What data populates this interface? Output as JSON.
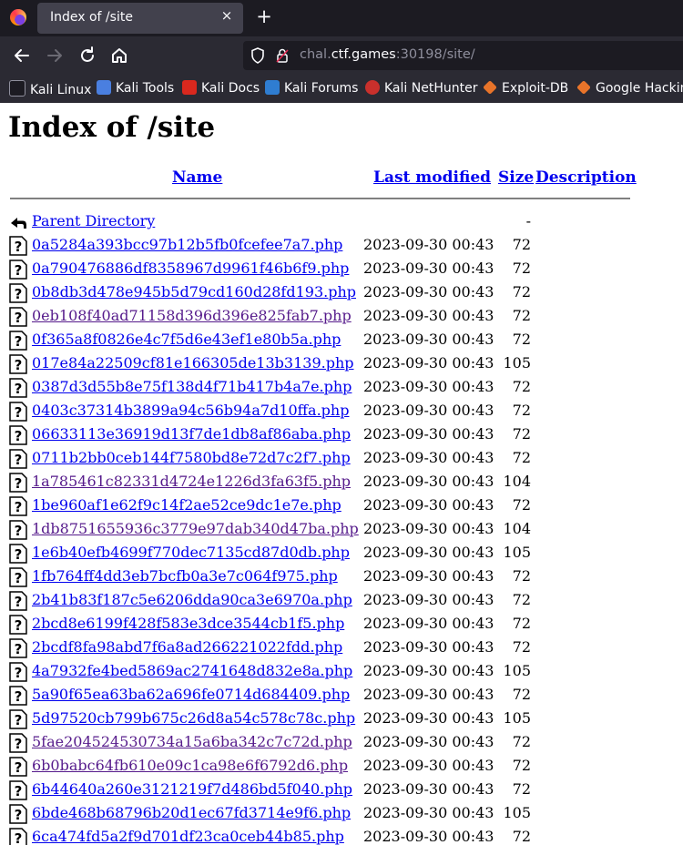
{
  "browser": {
    "tab_title": "Index of /site",
    "close_glyph": "×",
    "newtab_glyph": "+",
    "url_prefix": "chal.",
    "url_host": "ctf.games",
    "url_suffix": ":30198/site/",
    "bookmarks": [
      {
        "label": "Kali Linux",
        "color": "#3c7fc6"
      },
      {
        "label": "Kali Tools",
        "color": "#4a7fe0"
      },
      {
        "label": "Kali Docs",
        "color": "#d9281e"
      },
      {
        "label": "Kali Forums",
        "color": "#2f7dd1"
      },
      {
        "label": "Kali NetHunter",
        "color": "#c9302c"
      },
      {
        "label": "Exploit-DB",
        "color": "#e8742a"
      },
      {
        "label": "Google Hacking",
        "color": "#e8742a"
      }
    ]
  },
  "page": {
    "heading": "Index of /site",
    "columns": {
      "name": "Name",
      "modified": "Last modified",
      "size": "Size",
      "description": "Description"
    },
    "parent": {
      "name": "Parent Directory",
      "size": "-"
    },
    "rows": [
      {
        "name": "0a5284a393bcc97b12b5fb0fcefee7a7.php",
        "modified": "2023-09-30 00:43",
        "size": "72",
        "visited": false
      },
      {
        "name": "0a790476886df8358967d9961f46b6f9.php",
        "modified": "2023-09-30 00:43",
        "size": "72",
        "visited": false
      },
      {
        "name": "0b8db3d478e945b5d79cd160d28fd193.php",
        "modified": "2023-09-30 00:43",
        "size": "72",
        "visited": false
      },
      {
        "name": "0eb108f40ad71158d396d396e825fab7.php",
        "modified": "2023-09-30 00:43",
        "size": "72",
        "visited": true
      },
      {
        "name": "0f365a8f0826e4c7f5d6e43ef1e80b5a.php",
        "modified": "2023-09-30 00:43",
        "size": "72",
        "visited": false
      },
      {
        "name": "017e84a22509cf81e166305de13b3139.php",
        "modified": "2023-09-30 00:43",
        "size": "105",
        "visited": false
      },
      {
        "name": "0387d3d55b8e75f138d4f71b417b4a7e.php",
        "modified": "2023-09-30 00:43",
        "size": "72",
        "visited": false
      },
      {
        "name": "0403c37314b3899a94c56b94a7d10ffa.php",
        "modified": "2023-09-30 00:43",
        "size": "72",
        "visited": false
      },
      {
        "name": "06633113e36919d13f7de1db8af86aba.php",
        "modified": "2023-09-30 00:43",
        "size": "72",
        "visited": false
      },
      {
        "name": "0711b2bb0ceb144f7580bd8e72d7c2f7.php",
        "modified": "2023-09-30 00:43",
        "size": "72",
        "visited": false
      },
      {
        "name": "1a785461c82331d4724e1226d3fa63f5.php",
        "modified": "2023-09-30 00:43",
        "size": "104",
        "visited": true
      },
      {
        "name": "1be960af1e62f9c14f2ae52ce9dc1e7e.php",
        "modified": "2023-09-30 00:43",
        "size": "72",
        "visited": false
      },
      {
        "name": "1db8751655936c3779e97dab340d47ba.php",
        "modified": "2023-09-30 00:43",
        "size": "104",
        "visited": true
      },
      {
        "name": "1e6b40efb4699f770dec7135cd87d0db.php",
        "modified": "2023-09-30 00:43",
        "size": "105",
        "visited": false
      },
      {
        "name": "1fb764ff4dd3eb7bcfb0a3e7c064f975.php",
        "modified": "2023-09-30 00:43",
        "size": "72",
        "visited": false
      },
      {
        "name": "2b41b83f187c5e6206dda90ca3e6970a.php",
        "modified": "2023-09-30 00:43",
        "size": "72",
        "visited": false
      },
      {
        "name": "2bcd8e6199f428f583e3dce3544cb1f5.php",
        "modified": "2023-09-30 00:43",
        "size": "72",
        "visited": false
      },
      {
        "name": "2bcdf8fa98abd7f6a8ad266221022fdd.php",
        "modified": "2023-09-30 00:43",
        "size": "72",
        "visited": false
      },
      {
        "name": "4a7932fe4bed5869ac2741648d832e8a.php",
        "modified": "2023-09-30 00:43",
        "size": "105",
        "visited": false
      },
      {
        "name": "5a90f65ea63ba62a696fe0714d684409.php",
        "modified": "2023-09-30 00:43",
        "size": "72",
        "visited": false
      },
      {
        "name": "5d97520cb799b675c26d8a54c578c78c.php",
        "modified": "2023-09-30 00:43",
        "size": "105",
        "visited": false
      },
      {
        "name": "5fae204524530734a15a6ba342c7c72d.php",
        "modified": "2023-09-30 00:43",
        "size": "72",
        "visited": true
      },
      {
        "name": "6b0babc64fb610e09c1ca98e6f6792d6.php",
        "modified": "2023-09-30 00:43",
        "size": "72",
        "visited": true
      },
      {
        "name": "6b44640a260e3121219f7d486bd5f040.php",
        "modified": "2023-09-30 00:43",
        "size": "72",
        "visited": false
      },
      {
        "name": "6bde468b68796b20d1ec67fd3714e9f6.php",
        "modified": "2023-09-30 00:43",
        "size": "105",
        "visited": false
      },
      {
        "name": "6ca474fd5a2f9d701df23ca0ceb44b85.php",
        "modified": "2023-09-30 00:43",
        "size": "72",
        "visited": false
      }
    ]
  }
}
